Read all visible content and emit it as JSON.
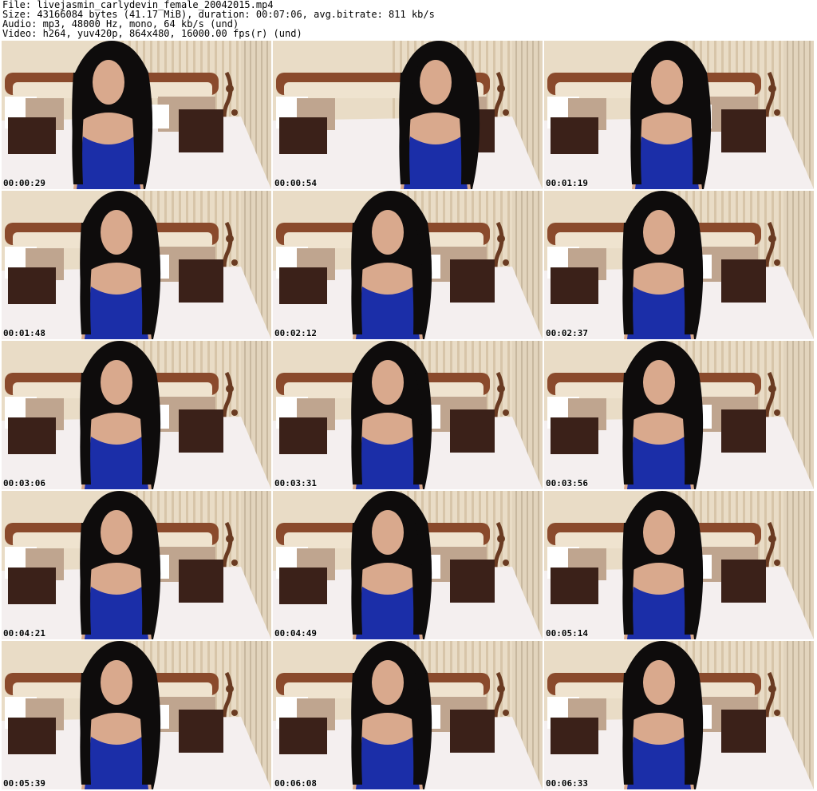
{
  "header": {
    "line1": "File: livejasmin_carlydevin_female_20042015.mp4",
    "line2": "Size: 43166084 bytes (41.17 MiB), duration: 00:07:06, avg.bitrate: 811 kb/s",
    "line3": "Audio: mp3, 48000 Hz, mono, 64 kb/s (und)",
    "line4": "Video: h264, yuv420p, 864x480, 16000.00 fps(r) (und)"
  },
  "thumbnails": [
    {
      "timestamp": "00:00:29"
    },
    {
      "timestamp": "00:00:54"
    },
    {
      "timestamp": "00:01:19"
    },
    {
      "timestamp": "00:01:48"
    },
    {
      "timestamp": "00:02:12"
    },
    {
      "timestamp": "00:02:37"
    },
    {
      "timestamp": "00:03:06"
    },
    {
      "timestamp": "00:03:31"
    },
    {
      "timestamp": "00:03:56"
    },
    {
      "timestamp": "00:04:21"
    },
    {
      "timestamp": "00:04:49"
    },
    {
      "timestamp": "00:05:14"
    },
    {
      "timestamp": "00:05:39"
    },
    {
      "timestamp": "00:06:08"
    },
    {
      "timestamp": "00:06:33"
    }
  ],
  "colors": {
    "wall": "#e9dcc6",
    "stripe": "#c9b391",
    "headboard": "#8a4a2c",
    "headboard_pad": "#efe3cf",
    "bed": "#f4efef",
    "pillow_plaid": "#bfa58f",
    "pillow_dark": "#3b2119",
    "dress": "#1b2ea8",
    "hair": "#0e0c0c",
    "skin": "#d9a98d",
    "curtain": "#e2d4bd",
    "lamp": "#6a3b22"
  }
}
